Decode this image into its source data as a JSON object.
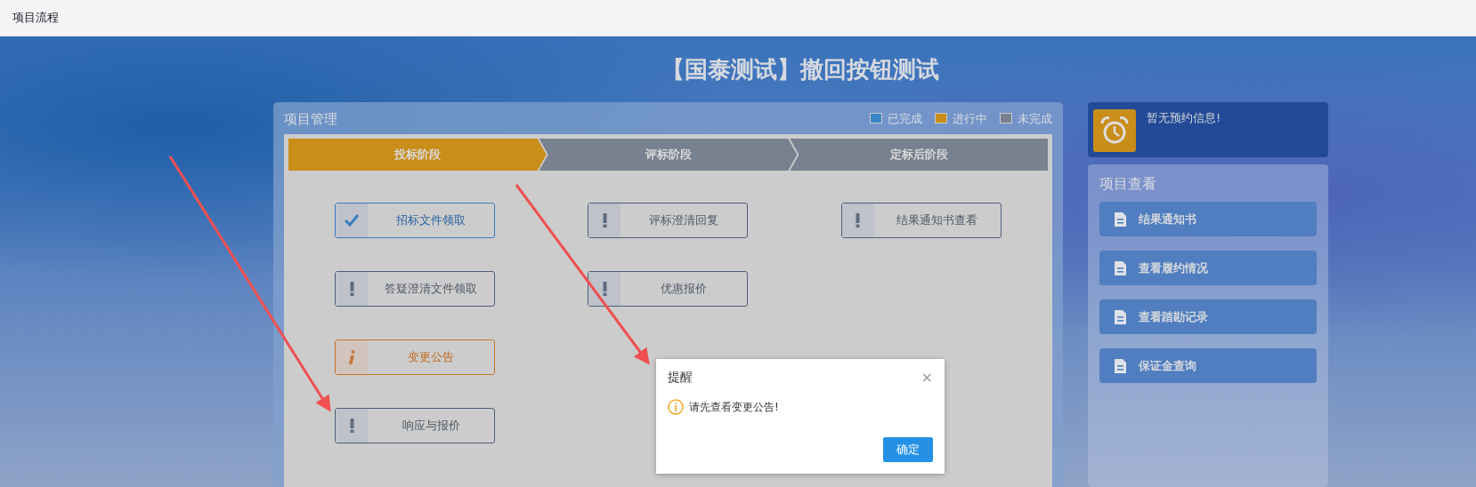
{
  "navbar": {
    "title": "项目流程"
  },
  "page_title": "【国泰测试】撤回按钮测试",
  "project_panel": {
    "title": "项目管理",
    "legend": [
      {
        "label": "已完成",
        "color": "#3a87c8"
      },
      {
        "label": "进行中",
        "color": "#c98d1a"
      },
      {
        "label": "未完成",
        "color": "#78818f"
      }
    ],
    "stages": [
      {
        "label": "投标阶段",
        "selected": true
      },
      {
        "label": "评标阶段",
        "selected": false
      },
      {
        "label": "定标后阶段",
        "selected": false
      }
    ],
    "columns": [
      [
        {
          "label": "招标文件领取",
          "kind": "done"
        },
        {
          "label": "答疑澄清文件领取",
          "kind": "pending"
        },
        {
          "label": "变更公告",
          "kind": "info"
        },
        {
          "label": "响应与报价",
          "kind": "pending"
        }
      ],
      [
        {
          "label": "评标澄清回复",
          "kind": "pending"
        },
        {
          "label": "优惠报价",
          "kind": "pending"
        }
      ],
      [
        {
          "label": "结果通知书查看",
          "kind": "pending"
        }
      ]
    ]
  },
  "reminder": {
    "text": "暂无预约信息!"
  },
  "sidebar": {
    "title": "项目查看",
    "items": [
      "结果通知书",
      "查看履约情况",
      "查看踏勘记录",
      "保证金查询"
    ]
  },
  "dialog": {
    "title": "提醒",
    "close": "×",
    "message": "请先查看变更公告!",
    "ok": "确定"
  }
}
